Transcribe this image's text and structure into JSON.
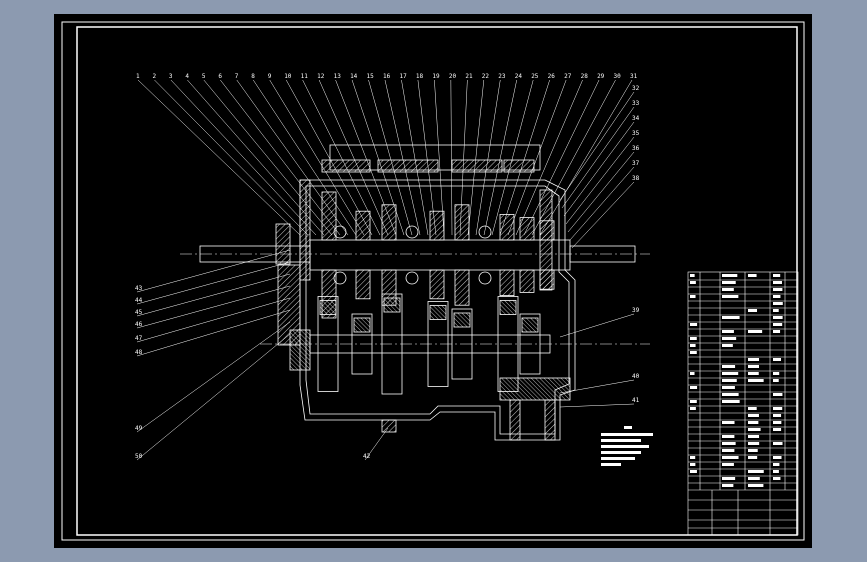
{
  "drawing": {
    "background_color": "#8c9ab0",
    "sheet_color": "#000000",
    "line_color": "#ffffff",
    "balloons": {
      "top": [
        "1",
        "2",
        "3",
        "4",
        "5",
        "6",
        "7",
        "8",
        "9",
        "10",
        "11",
        "12",
        "13",
        "14",
        "15",
        "16",
        "17",
        "18",
        "19",
        "20",
        "21",
        "22",
        "23",
        "24",
        "25",
        "26",
        "27",
        "28",
        "29",
        "30",
        "31"
      ],
      "right": [
        "32",
        "33",
        "34",
        "35",
        "36",
        "37",
        "38"
      ],
      "right_lower": [
        "39",
        "40",
        "41"
      ],
      "bottom": [
        "42"
      ],
      "left": [
        "43",
        "44",
        "45",
        "46",
        "47",
        "48",
        "49",
        "50"
      ]
    }
  }
}
